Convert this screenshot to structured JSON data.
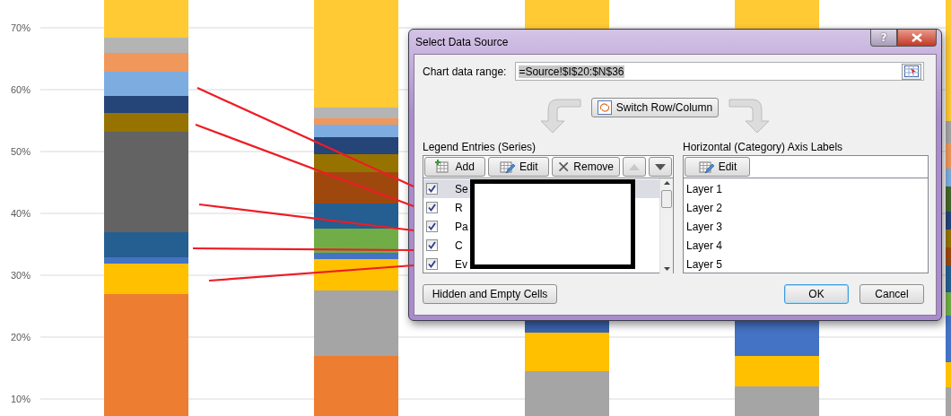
{
  "chart": {
    "y_tick_labels": [
      "70%",
      "60%",
      "50%",
      "40%",
      "30%",
      "20%",
      "10%"
    ]
  },
  "dialog": {
    "title": "Select Data Source",
    "help": "?",
    "data_range": {
      "label": "Chart data range:",
      "value": "=Source!$I$20:$N$36"
    },
    "switch_button": "Switch Row/Column",
    "legend": {
      "label": "Legend Entries (Series)",
      "buttons": [
        {
          "kind": "add",
          "label": "Add",
          "disabled": false
        },
        {
          "kind": "edit",
          "label": "Edit",
          "disabled": false
        },
        {
          "kind": "remove",
          "label": "Remove",
          "disabled": false
        },
        {
          "kind": "up",
          "disabled": true
        },
        {
          "kind": "down",
          "disabled": false
        }
      ],
      "entries": [
        {
          "label": "Se",
          "checked": true,
          "selected": true
        },
        {
          "label": "R",
          "checked": true,
          "selected": false
        },
        {
          "label": "Pa",
          "checked": true,
          "selected": false
        },
        {
          "label": "C",
          "checked": true,
          "selected": false
        },
        {
          "label": "Ev",
          "checked": true,
          "selected": false
        }
      ]
    },
    "axis": {
      "label": "Horizontal (Category) Axis Labels",
      "edit_button": "Edit",
      "items": [
        "Layer 1",
        "Layer 2",
        "Layer 3",
        "Layer 4",
        "Layer 5"
      ]
    },
    "hidden_button": "Hidden and Empty Cells",
    "ok_button": "OK",
    "cancel_button": "Cancel"
  }
}
